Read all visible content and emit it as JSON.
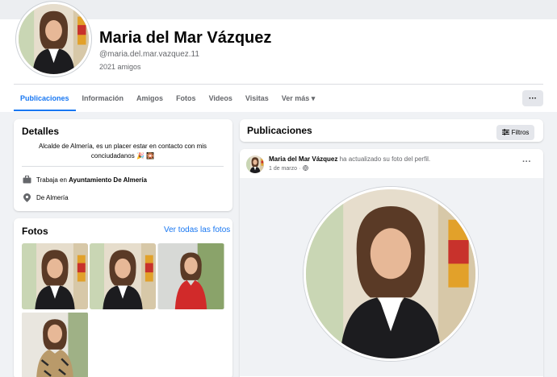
{
  "profile": {
    "name": "Maria del Mar Vázquez",
    "handle": "@maria.del.mar.vazquez.11",
    "friends": "2021 amigos"
  },
  "tabs": [
    {
      "label": "Publicaciones",
      "active": true
    },
    {
      "label": "Información"
    },
    {
      "label": "Amigos"
    },
    {
      "label": "Fotos"
    },
    {
      "label": "Videos"
    },
    {
      "label": "Visitas"
    },
    {
      "label": "Ver más ▾"
    }
  ],
  "more_button": "···",
  "details": {
    "title": "Detalles",
    "bio": "Alcalde de Almería, es un placer estar en contacto con mis conciudadanos 🎉 🎇",
    "work_prefix": "Trabaja en ",
    "work_place": "Ayuntamiento De Almería",
    "location": "De Almería"
  },
  "photos": {
    "title": "Fotos",
    "see_all": "Ver todas las fotos",
    "items": [
      "photo-1",
      "photo-2",
      "photo-3",
      "photo-4"
    ]
  },
  "posts_header": {
    "title": "Publicaciones",
    "filter": "Filtros"
  },
  "post": {
    "author": "Maria del Mar Vázquez",
    "action": " ha actualizado su foto del perfil.",
    "date": "1 de marzo ·",
    "menu": "···"
  },
  "icons": [
    "briefcase-icon",
    "location-pin-icon",
    "globe-icon",
    "filter-icon"
  ],
  "colors": {
    "accent": "#1877f2",
    "background": "#f0f2f5",
    "muted_text": "#65676b"
  }
}
